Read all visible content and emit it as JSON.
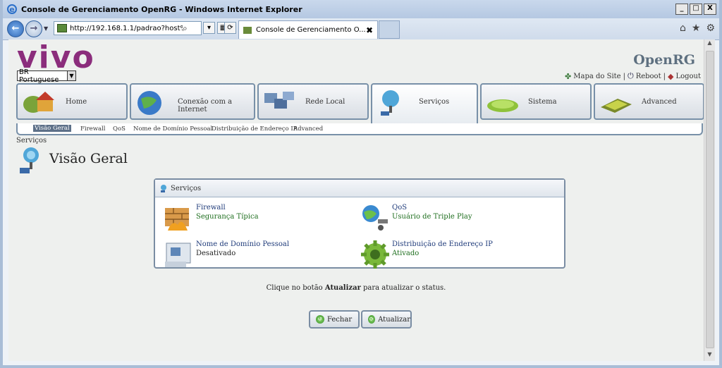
{
  "browser": {
    "window_title": "Console de Gerenciamento OpenRG - Windows Internet Explorer",
    "address": "http://192.168.1.1/padrao?host%5fm",
    "tab_title": "Console de Gerenciamento O...",
    "tab_close": "✖",
    "winbtn_min": "_",
    "winbtn_max": "□",
    "winbtn_close": "X",
    "icons": [
      "back-icon",
      "forward-icon",
      "search-icon",
      "refresh-icon",
      "compat-icon",
      "home-icon",
      "favorites-icon",
      "tools-icon"
    ]
  },
  "header": {
    "brand_logo": "vivo",
    "language": "BR Portuguese",
    "openrg_logo": "OpenRG",
    "links": {
      "sitemap": "Mapa do Site",
      "sep1": "|",
      "reboot": "Reboot",
      "sep2": "|",
      "logout": "Logout"
    }
  },
  "main_nav": [
    {
      "label": "Home",
      "active": false
    },
    {
      "label": "Conexão com a Internet",
      "active": false
    },
    {
      "label": "Rede Local",
      "active": false
    },
    {
      "label": "Serviços",
      "active": true
    },
    {
      "label": "Sistema",
      "active": false
    },
    {
      "label": "Advanced",
      "active": false
    }
  ],
  "sub_nav": [
    {
      "label": "Visão Geral",
      "active": true
    },
    {
      "label": "Firewall",
      "active": false
    },
    {
      "label": "QoS",
      "active": false
    },
    {
      "label": "Nome de Domínio Pessoal",
      "active": false
    },
    {
      "label": "Distribuição de Endereço IP",
      "active": false
    },
    {
      "label": "Advanced",
      "active": false
    }
  ],
  "breadcrumb": "Serviços",
  "page_title": "Visão Geral",
  "panel": {
    "title": "Serviços",
    "items": [
      {
        "name": "Firewall",
        "status": "Segurança Típica"
      },
      {
        "name": "QoS",
        "status": "Usuário de Triple Play"
      },
      {
        "name": "Nome de Domínio Pessoal",
        "status": "Desativado"
      },
      {
        "name": "Distribuição de Endereço IP",
        "status": "Ativado"
      }
    ]
  },
  "message": {
    "prefix": "Clique no botão ",
    "bold": "Atualizar",
    "suffix": " para atualizar o status."
  },
  "buttons": {
    "close": "Fechar",
    "refresh": "Atualizar"
  },
  "colors": {
    "brand": "#8b2d7c",
    "tab_border": "#7890a8",
    "status_green": "#1e6e1e",
    "link_blue": "#1f3b7a"
  }
}
